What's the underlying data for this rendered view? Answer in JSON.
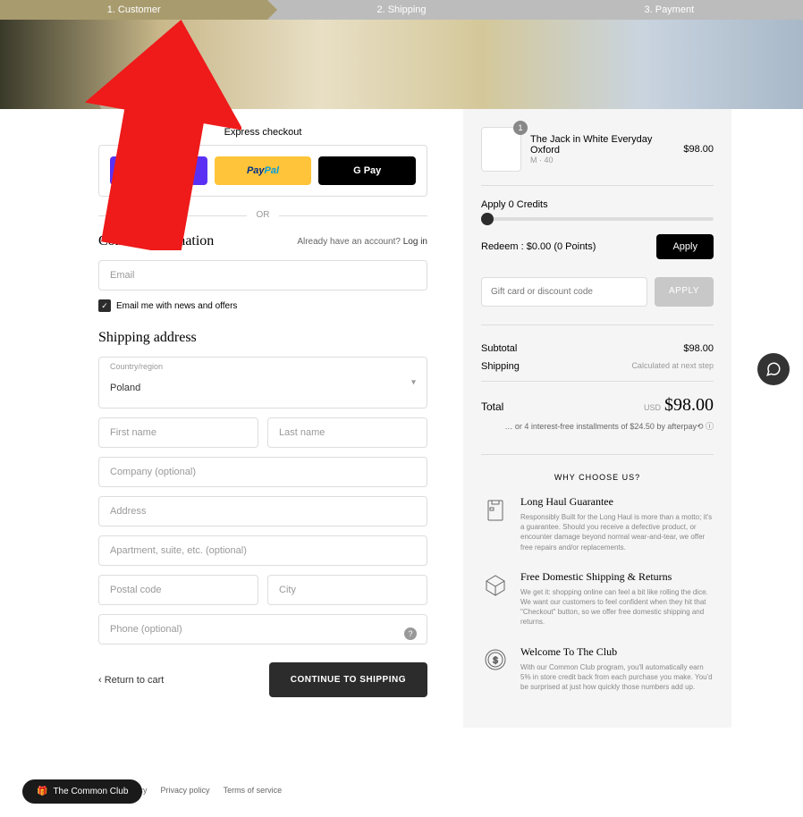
{
  "progress": {
    "step1": "1. Customer",
    "step2": "2. Shipping",
    "step3": "3. Payment"
  },
  "express": {
    "title": "Express checkout",
    "shop_pay": "Pay",
    "paypal": "PayPal",
    "gpay": "G Pay",
    "or": "OR"
  },
  "contact": {
    "title": "Contact information",
    "already": "Already have an account?",
    "login": "Log in",
    "email_placeholder": "Email",
    "news_label": "Email me with news and offers"
  },
  "shipping": {
    "title": "Shipping address",
    "country_label": "Country/region",
    "country_value": "Poland",
    "first_name": "First name",
    "last_name": "Last name",
    "company": "Company (optional)",
    "address": "Address",
    "apartment": "Apartment, suite, etc. (optional)",
    "postal": "Postal code",
    "city": "City",
    "phone": "Phone (optional)"
  },
  "actions": {
    "return": "‹ Return to cart",
    "continue": "CONTINUE TO SHIPPING"
  },
  "cart": {
    "item_name": "The Jack in White Everyday Oxford",
    "item_variant": "M · 40",
    "item_qty": "1",
    "item_price": "$98.00"
  },
  "credits": {
    "apply_label": "Apply 0 Credits",
    "redeem_text": "Redeem : $0.00 (0 Points)",
    "apply_btn": "Apply"
  },
  "promo": {
    "placeholder": "Gift card or discount code",
    "apply": "APPLY"
  },
  "summary": {
    "subtotal_label": "Subtotal",
    "subtotal_value": "$98.00",
    "shipping_label": "Shipping",
    "shipping_value": "Calculated at next step",
    "total_label": "Total",
    "total_currency": "USD",
    "total_value": "$98.00",
    "afterpay": "… or 4 interest-free installments of $24.50 by afterpay⟲ ⓘ"
  },
  "why": {
    "header": "WHY CHOOSE US?",
    "b1_title": "Long Haul Guarantee",
    "b1_desc": "Responsibly Built for the Long Haul is more than a motto; it's a guarantee. Should you receive a defective product, or encounter damage beyond normal wear-and-tear, we offer free repairs and/or replacements.",
    "b2_title": "Free Domestic Shipping & Returns",
    "b2_desc": "We get it: shopping online can feel a bit like rolling the dice. We want our customers to feel confident when they hit that \"Checkout\" button, so we offer free domestic shipping and returns.",
    "b3_title": "Welcome To The Club",
    "b3_desc": "With our Common Club program, you'll automatically earn 5% in store credit back from each purchase you make. You'd be surprised at just how quickly those numbers add up."
  },
  "club": {
    "label": "The Common Club"
  },
  "footer": {
    "refund": "Refund policy",
    "privacy": "Privacy policy",
    "terms": "Terms of service"
  }
}
